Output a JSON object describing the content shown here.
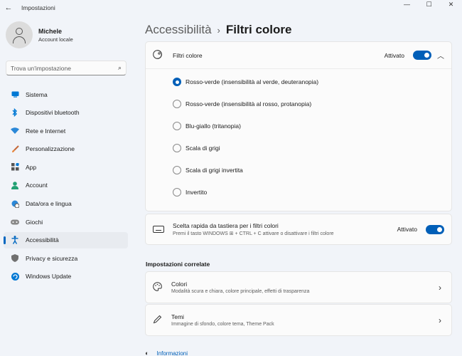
{
  "window": {
    "title": "Impostazioni",
    "back_glyph": "←",
    "minimize_glyph": "—",
    "maximize_glyph": "☐",
    "close_glyph": "✕"
  },
  "profile": {
    "name": "Michele",
    "account_type": "Account locale"
  },
  "search": {
    "placeholder": "Trova un'impostazione",
    "icon": "search-icon"
  },
  "sidebar": {
    "items": [
      {
        "label": "Sistema",
        "icon": "system-icon",
        "color": "#0078d4"
      },
      {
        "label": "Dispositivi bluetooth",
        "icon": "bluetooth-icon",
        "color": "#0078d4"
      },
      {
        "label": "Rete e Internet",
        "icon": "wifi-icon",
        "color": "#2b88d8"
      },
      {
        "label": "Personalizzazione",
        "icon": "brush-icon",
        "color": "#e8863a"
      },
      {
        "label": "App",
        "icon": "apps-icon",
        "color": "#555555"
      },
      {
        "label": "Account",
        "icon": "account-icon",
        "color": "#22a073"
      },
      {
        "label": "Data/ora e lingua",
        "icon": "globe-clock-icon",
        "color": "#2b88d8"
      },
      {
        "label": "Giochi",
        "icon": "gamepad-icon",
        "color": "#777777"
      },
      {
        "label": "Accessibilità",
        "icon": "accessibility-icon",
        "color": "#0067c0",
        "active": true
      },
      {
        "label": "Privacy e sicurezza",
        "icon": "shield-icon",
        "color": "#666666"
      },
      {
        "label": "Windows Update",
        "icon": "update-icon",
        "color": "#0078d4"
      }
    ]
  },
  "breadcrumb": {
    "parent": "Accessibilità",
    "separator": "›",
    "current": "Filtri colore"
  },
  "color_filters": {
    "title": "Filtri colore",
    "state": "Attivato",
    "enabled": true,
    "chevron": "︿",
    "options": [
      {
        "label": "Rosso-verde (insensibilità al verde, deuteranopia)",
        "checked": true
      },
      {
        "label": "Rosso-verde (insensibilità al rosso, protanopia)",
        "checked": false
      },
      {
        "label": "Blu-giallo (tritanopia)",
        "checked": false
      },
      {
        "label": "Scala di grigi",
        "checked": false
      },
      {
        "label": "Scala di grigi invertita",
        "checked": false
      },
      {
        "label": "Invertito",
        "checked": false
      }
    ]
  },
  "shortcut": {
    "title": "Scelta rapida da tastiera per i filtri colori",
    "description": "Premi il tasto WINDOWS ⊞ + CTRL + C attivare o disattivare i filtri colore",
    "state": "Attivato",
    "enabled": true
  },
  "related": {
    "heading": "Impostazioni correlate",
    "items": [
      {
        "title": "Colori",
        "description": "Modalità scura e chiara, colore principale, effetti di trasparenza",
        "icon": "palette-icon"
      },
      {
        "title": "Temi",
        "description": "Immagine di sfondo, colore tema, Theme Pack",
        "icon": "pen-icon"
      }
    ]
  },
  "footer": {
    "link": "Informazioni"
  },
  "colors": {
    "accent": "#005fb8",
    "background": "#f1f4f9",
    "card": "#fbfbfb"
  }
}
